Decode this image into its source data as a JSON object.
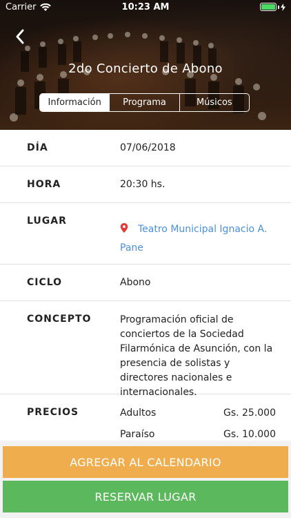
{
  "status_bar": {
    "carrier": "Carrier",
    "time": "10:23 AM",
    "battery_color": "#4cd964"
  },
  "header": {
    "title": "2do Concierto de Abono",
    "back_icon": "chevron-left-icon",
    "tabs": [
      {
        "label": "Información",
        "active": true
      },
      {
        "label": "Programa",
        "active": false
      },
      {
        "label": "Músicos",
        "active": false
      }
    ]
  },
  "info": {
    "dia": {
      "label": "DÍA",
      "value": "07/06/2018"
    },
    "hora": {
      "label": "HORA",
      "value": "20:30 hs."
    },
    "lugar": {
      "label": "LUGAR",
      "value": "Teatro Municipal Ignacio A. Pane",
      "icon": "map-pin-icon",
      "link_color": "#4a90d9",
      "icon_color": "#e53935"
    },
    "ciclo": {
      "label": "CICLO",
      "value": "Abono"
    },
    "concepto": {
      "label": "CONCEPTO",
      "value": "Programación oficial de conciertos de la Sociedad Filarmónica de Asunción, con la presencia de solistas y directores nacionales e internacionales."
    },
    "precios": {
      "label": "PRECIOS",
      "items": [
        {
          "name": "Adultos",
          "price": "Gs. 25.000"
        },
        {
          "name": "Paraíso",
          "price": "Gs. 10.000"
        }
      ]
    }
  },
  "actions": {
    "calendar": {
      "label": "AGREGAR AL CALENDARIO",
      "color": "#f0ad4e"
    },
    "reserve": {
      "label": "RESERVAR LUGAR",
      "color": "#5cb85c"
    }
  }
}
